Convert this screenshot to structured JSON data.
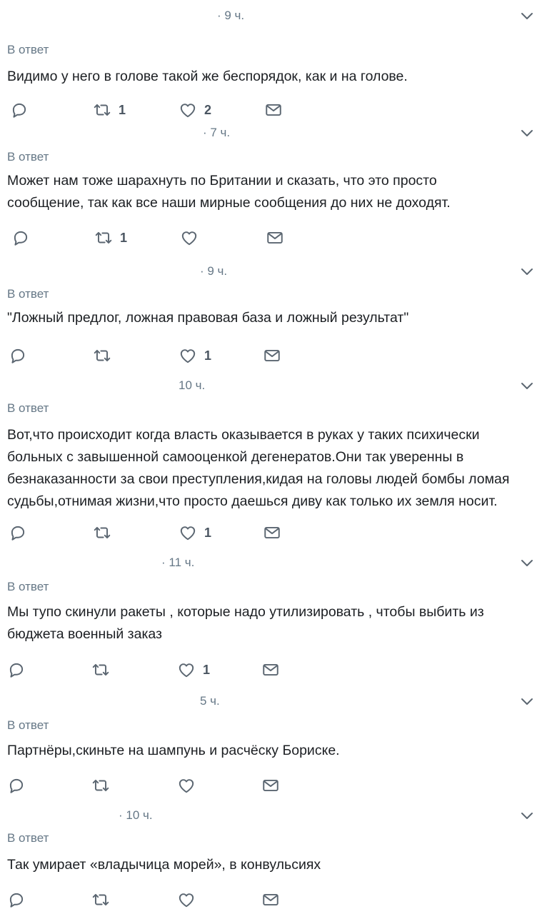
{
  "tweets": [
    {
      "time": "· 9 ч.",
      "reply_label": "В ответ",
      "text_lines": [
        "Видимо у него в голове такой же беспорядок, как и на голове."
      ],
      "retweets": "1",
      "likes": "2"
    },
    {
      "time": "· 7 ч.",
      "reply_label": "В ответ",
      "text_lines": [
        "Может нам тоже шарахнуть по Британии и сказать, что это просто",
        "сообщение, так как все наши мирные сообщения до них не доходят."
      ],
      "retweets": "1",
      "likes": ""
    },
    {
      "time": "· 9 ч.",
      "reply_label": "В ответ",
      "text_lines": [
        "\"Ложный предлог, ложная правовая база и ложный результат\""
      ],
      "retweets": "",
      "likes": "1"
    },
    {
      "time": "10 ч.",
      "reply_label": "В ответ",
      "text_lines": [
        "Вот,что происходит когда власть оказывается в руках у таких психически",
        "больных с завышенной самооценкой дегенератов.Они так уверенны в",
        "безнаказанности за свои преступления,кидая на головы людей бомбы ломая",
        "судьбы,отнимая жизни,что просто даешься диву как только их земля носит."
      ],
      "retweets": "",
      "likes": "1"
    },
    {
      "time": "· 11 ч.",
      "reply_label": "В ответ",
      "text_lines": [
        "Мы тупо скинули ракеты , которые надо утилизировать , чтобы выбить из",
        "бюджета военный заказ"
      ],
      "retweets": "",
      "likes": "1"
    },
    {
      "time": "5 ч.",
      "reply_label": "В ответ",
      "text_lines": [
        "Партнёры,скиньте на шампунь и расчёску Бориске."
      ],
      "retweets": "",
      "likes": ""
    },
    {
      "time": "· 10 ч.",
      "reply_label": "В ответ",
      "text_lines": [
        "Так умирает «владычица морей», в конвульсиях"
      ],
      "retweets": "",
      "likes": ""
    }
  ],
  "icons": {
    "reply": "reply-icon",
    "retweet": "retweet-icon",
    "like": "heart-icon",
    "message": "envelope-icon",
    "more": "chevron-down-icon"
  },
  "colors": {
    "text": "#1c1f23",
    "secondary": "#657786",
    "icon": "#5b6671"
  }
}
